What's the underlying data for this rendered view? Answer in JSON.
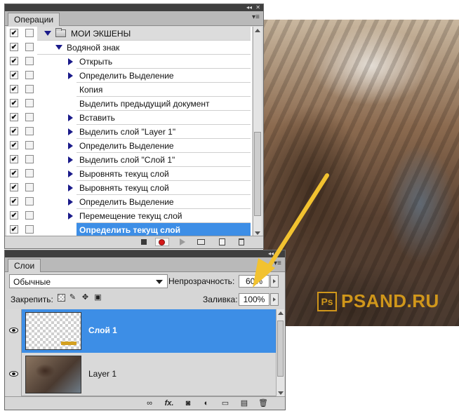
{
  "actions_panel": {
    "tab_label": "Операции",
    "collapse_glyph": "◂◂",
    "close_glyph": "✕",
    "menu_glyph": "▾≡",
    "rows": [
      {
        "text": "МОИ ЭКШЕНЫ",
        "kind": "set",
        "check1": true,
        "check2": false,
        "expander": "down"
      },
      {
        "text": "Водяной знак",
        "kind": "action",
        "check1": true,
        "check2": false,
        "expander": "down"
      },
      {
        "text": "Открыть",
        "kind": "step",
        "check1": true,
        "check2": false,
        "expander": "right"
      },
      {
        "text": "Определить Выделение",
        "kind": "step",
        "check1": true,
        "check2": false,
        "expander": "right"
      },
      {
        "text": "Копия",
        "kind": "step",
        "check1": true,
        "check2": false,
        "expander": "none"
      },
      {
        "text": "Выделить  предыдущий документ",
        "kind": "step",
        "check1": true,
        "check2": false,
        "expander": "none"
      },
      {
        "text": "Вставить",
        "kind": "step",
        "check1": true,
        "check2": false,
        "expander": "right"
      },
      {
        "text": "Выделить слой \"Layer 1\"",
        "kind": "step",
        "check1": true,
        "check2": false,
        "expander": "right"
      },
      {
        "text": "Определить Выделение",
        "kind": "step",
        "check1": true,
        "check2": false,
        "expander": "right"
      },
      {
        "text": "Выделить слой \"Слой 1\"",
        "kind": "step",
        "check1": true,
        "check2": false,
        "expander": "right"
      },
      {
        "text": "Выровнять текущ слой",
        "kind": "step",
        "check1": true,
        "check2": false,
        "expander": "right"
      },
      {
        "text": "Выровнять текущ слой",
        "kind": "step",
        "check1": true,
        "check2": false,
        "expander": "right"
      },
      {
        "text": "Определить Выделение",
        "kind": "step",
        "check1": true,
        "check2": false,
        "expander": "right"
      },
      {
        "text": "Перемещение текущ слой",
        "kind": "step",
        "check1": true,
        "check2": false,
        "expander": "right"
      },
      {
        "text": "Определить текущ слой",
        "kind": "step-selected",
        "check1": true,
        "check2": false,
        "expander": "right"
      }
    ],
    "check_glyph": "✔",
    "footer_icons": [
      "stop-icon",
      "record-icon",
      "play-icon",
      "new-set-icon",
      "new-action-icon",
      "delete-icon"
    ]
  },
  "layers_panel": {
    "tab_label": "Слои",
    "blend_mode": "Обычные",
    "opacity_label": "Непрозрачность:",
    "opacity_value": "60%",
    "lock_label": "Закрепить:",
    "fill_label": "Заливка:",
    "fill_value": "100%",
    "layers": [
      {
        "name": "Слой 1",
        "selected": true,
        "visible": true,
        "thumbnail": "transparent-with-watermark"
      },
      {
        "name": "Layer 1",
        "selected": false,
        "visible": true,
        "thumbnail": "cat-photo"
      }
    ],
    "footer_icons": [
      "link-icon",
      "fx-icon",
      "mask-icon",
      "adjustment-icon",
      "group-folder-icon",
      "new-layer-icon",
      "delete-icon"
    ],
    "footer_fx_text": "fx."
  },
  "canvas": {
    "watermark_text": "PSAND.RU",
    "watermark_logo": "Ps",
    "arrow_color": "#f2c230"
  },
  "colors": {
    "selection": "#3d8ee6",
    "panel_bg": "#d6d6d6",
    "watermark": "#e0a21a"
  }
}
